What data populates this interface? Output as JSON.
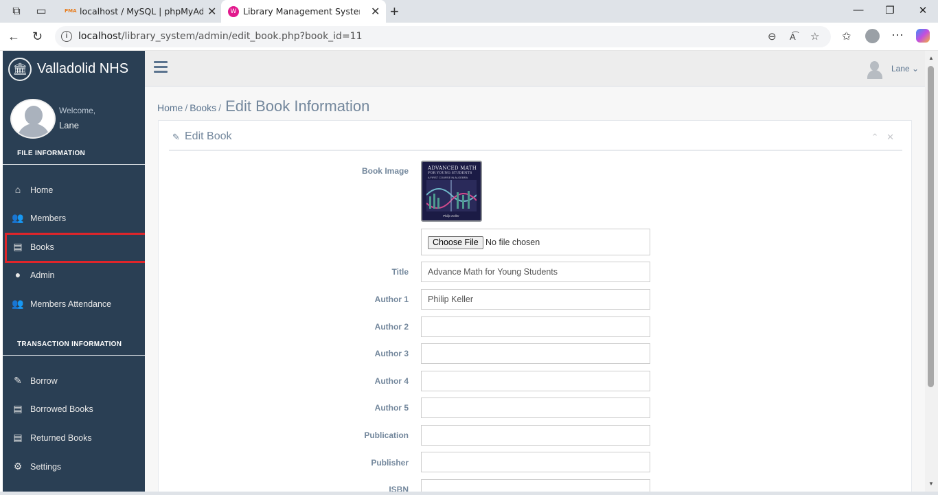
{
  "browser": {
    "tabs": [
      {
        "title": "localhost / MySQL | phpMyAdmin"
      },
      {
        "title": "Library Management System"
      }
    ],
    "url_host": "localhost",
    "url_path": "/library_system/admin/edit_book.php?book_id=11"
  },
  "sidebar": {
    "brand": "Valladolid NHS",
    "welcome": "Welcome,",
    "user": "Lane",
    "section1": "FILE INFORMATION",
    "section2": "TRANSACTION INFORMATION",
    "items": [
      {
        "label": "Home",
        "icon": "home-icon"
      },
      {
        "label": "Members",
        "icon": "users-icon"
      },
      {
        "label": "Books",
        "icon": "book-icon"
      },
      {
        "label": "Admin",
        "icon": "user-icon"
      },
      {
        "label": "Members Attendance",
        "icon": "users-icon"
      },
      {
        "label": "Borrow",
        "icon": "edit-icon"
      },
      {
        "label": "Borrowed Books",
        "icon": "book-icon"
      },
      {
        "label": "Returned Books",
        "icon": "book-icon"
      },
      {
        "label": "Settings",
        "icon": "gear-icon"
      }
    ],
    "highlight_color": "#e0252a"
  },
  "topnav": {
    "user": "Lane"
  },
  "breadcrumb": {
    "home": "Home",
    "books": "Books",
    "title": "Edit Book Information"
  },
  "panel": {
    "title": "Edit Book"
  },
  "book_image": {
    "title_line1": "ADVANCED MATH",
    "title_line2": "FOR YOUNG STUDENTS",
    "subtitle": "A FIRST COURSE IN ALGEBRA",
    "author": "Philip Keller"
  },
  "form": {
    "book_image_label": "Book Image",
    "file_button": "Choose File",
    "file_status": "No file chosen",
    "fields": [
      {
        "label": "Title",
        "value": "Advance Math for Young Students"
      },
      {
        "label": "Author 1",
        "value": "Philip Keller"
      },
      {
        "label": "Author 2",
        "value": ""
      },
      {
        "label": "Author 3",
        "value": ""
      },
      {
        "label": "Author 4",
        "value": ""
      },
      {
        "label": "Author 5",
        "value": ""
      },
      {
        "label": "Publication",
        "value": ""
      },
      {
        "label": "Publisher",
        "value": ""
      },
      {
        "label": "ISBN",
        "value": ""
      }
    ]
  },
  "colors": {
    "sidebar": "#2a3f54",
    "text": "#73879c"
  }
}
